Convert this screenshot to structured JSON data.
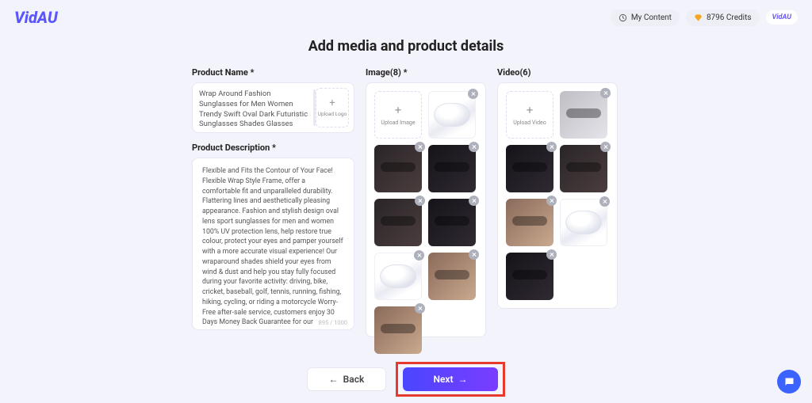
{
  "header": {
    "logo_text": "VidAU",
    "my_content": "My Content",
    "credits_text": "8796 Credits",
    "brand_chip": "VidAU"
  },
  "page_title": "Add media and product details",
  "product_name": {
    "label": "Product Name *",
    "value": "Wrap Around Fashion Sunglasses for Men Women Trendy Swift Oval Dark Futuristic Sunglasses Shades Glasses",
    "upload_logo_label": "Upload Logo"
  },
  "product_description": {
    "label": "Product Description *",
    "value": "Flexible and Fits the Contour of Your Face! Flexible Wrap Style Frame, offer a comfortable fit and unparalleled durability.\nFlattering lines and aesthetically pleasing appearance. Fashion and stylish design oval lens sport sunglasses for men and women\n100% UV protection lens, help restore true colour, protect your eyes and pamper yourself with a more accurate visual experience!\nOur wraparound shades shield your eyes from wind & dust and help you stay fully focused during your favorite activity: driving, bike, cricket, baseball, golf, tennis, running, fishing, hiking, cycling, or riding a motorcycle\nWorry-Free after-sale service, customers enjoy 30 Days Money Back Guarantee for our",
    "counter": "895 / 1000"
  },
  "image_section": {
    "label": "Image(8) *",
    "upload_label": "Upload Image"
  },
  "video_section": {
    "label": "Video(6)",
    "upload_label": "Upload Video"
  },
  "footer": {
    "back": "Back",
    "next": "Next"
  }
}
